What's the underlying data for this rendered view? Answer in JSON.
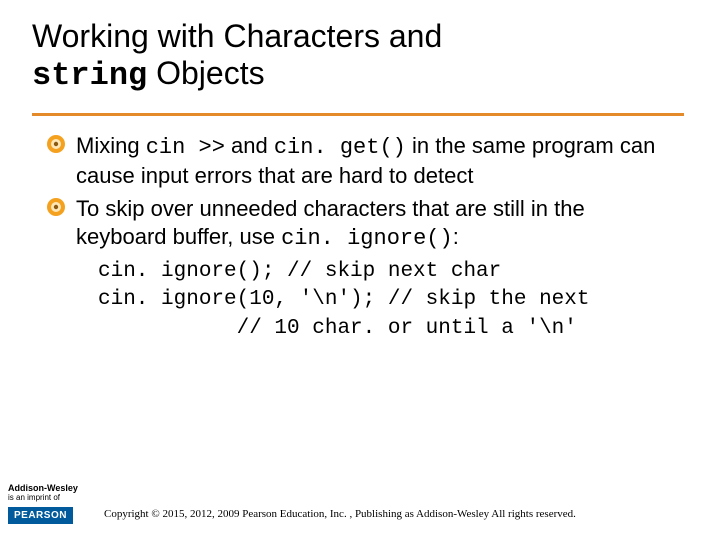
{
  "title": {
    "line1_a": "Working with Characters and",
    "line2_code": "string",
    "line2_rest": " Objects"
  },
  "bullets": [
    {
      "parts": [
        {
          "t": "Mixing ",
          "mono": false
        },
        {
          "t": "cin >>",
          "mono": true
        },
        {
          "t": " and ",
          "mono": false
        },
        {
          "t": "cin. get()",
          "mono": true
        },
        {
          "t": " in the same program can cause input errors that are hard to detect",
          "mono": false
        }
      ]
    },
    {
      "parts": [
        {
          "t": "To skip over unneeded characters that are still in the keyboard buffer, use ",
          "mono": false
        },
        {
          "t": "cin. ignore()",
          "mono": true
        },
        {
          "t": ":",
          "mono": false
        }
      ]
    }
  ],
  "code_block": "cin. ignore(); // skip next char\ncin. ignore(10, '\\n'); // skip the next\n           // 10 char. or until a '\\n'",
  "footer": {
    "brand1": "Addison-Wesley",
    "imprint": "is an imprint of",
    "brand2": "PEARSON",
    "copyright": "Copyright © 2015, 2012, 2009 Pearson Education, Inc. , Publishing as Addison-Wesley All rights reserved."
  }
}
